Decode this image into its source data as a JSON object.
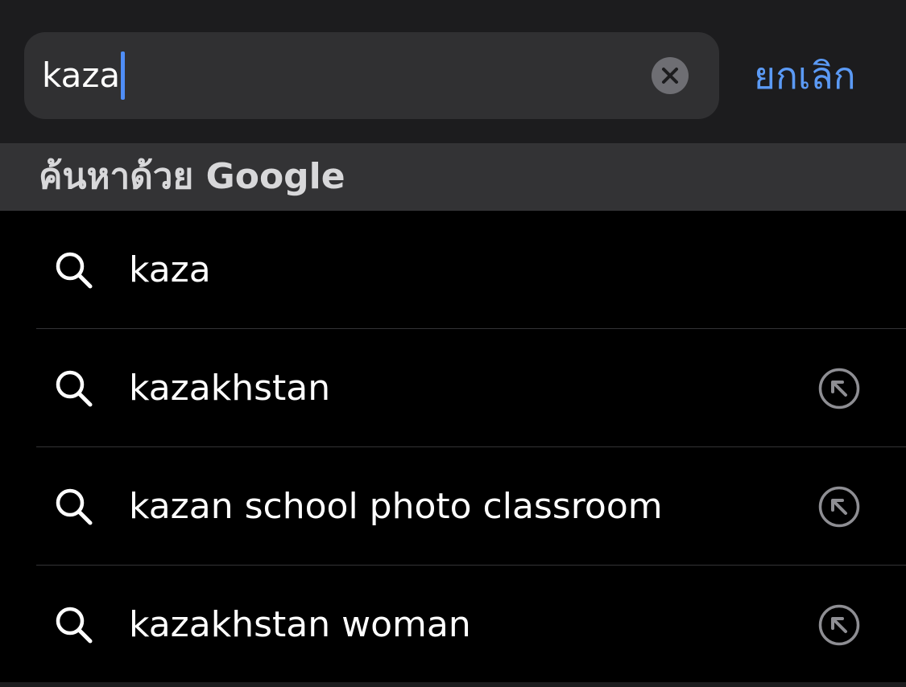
{
  "search": {
    "query": "kaza",
    "cancel_label": "ยกเลิก"
  },
  "section": {
    "title": "ค้นหาด้วย Google"
  },
  "suggestions": [
    {
      "label": "kaza",
      "has_fill_arrow": false
    },
    {
      "label": "kazakhstan",
      "has_fill_arrow": true
    },
    {
      "label": "kazan school photo classroom",
      "has_fill_arrow": true
    },
    {
      "label": "kazakhstan woman",
      "has_fill_arrow": true
    }
  ],
  "icons": {
    "clear": "clear-icon",
    "search": "search-icon",
    "fill_suggestion": "arrow-up-left-circle-icon"
  },
  "colors": {
    "accent": "#5b9af5",
    "caret": "#4f8ef7",
    "background": "#000000",
    "top_bar": "#1c1c1e",
    "field": "#303032",
    "section_header": "#333335"
  }
}
